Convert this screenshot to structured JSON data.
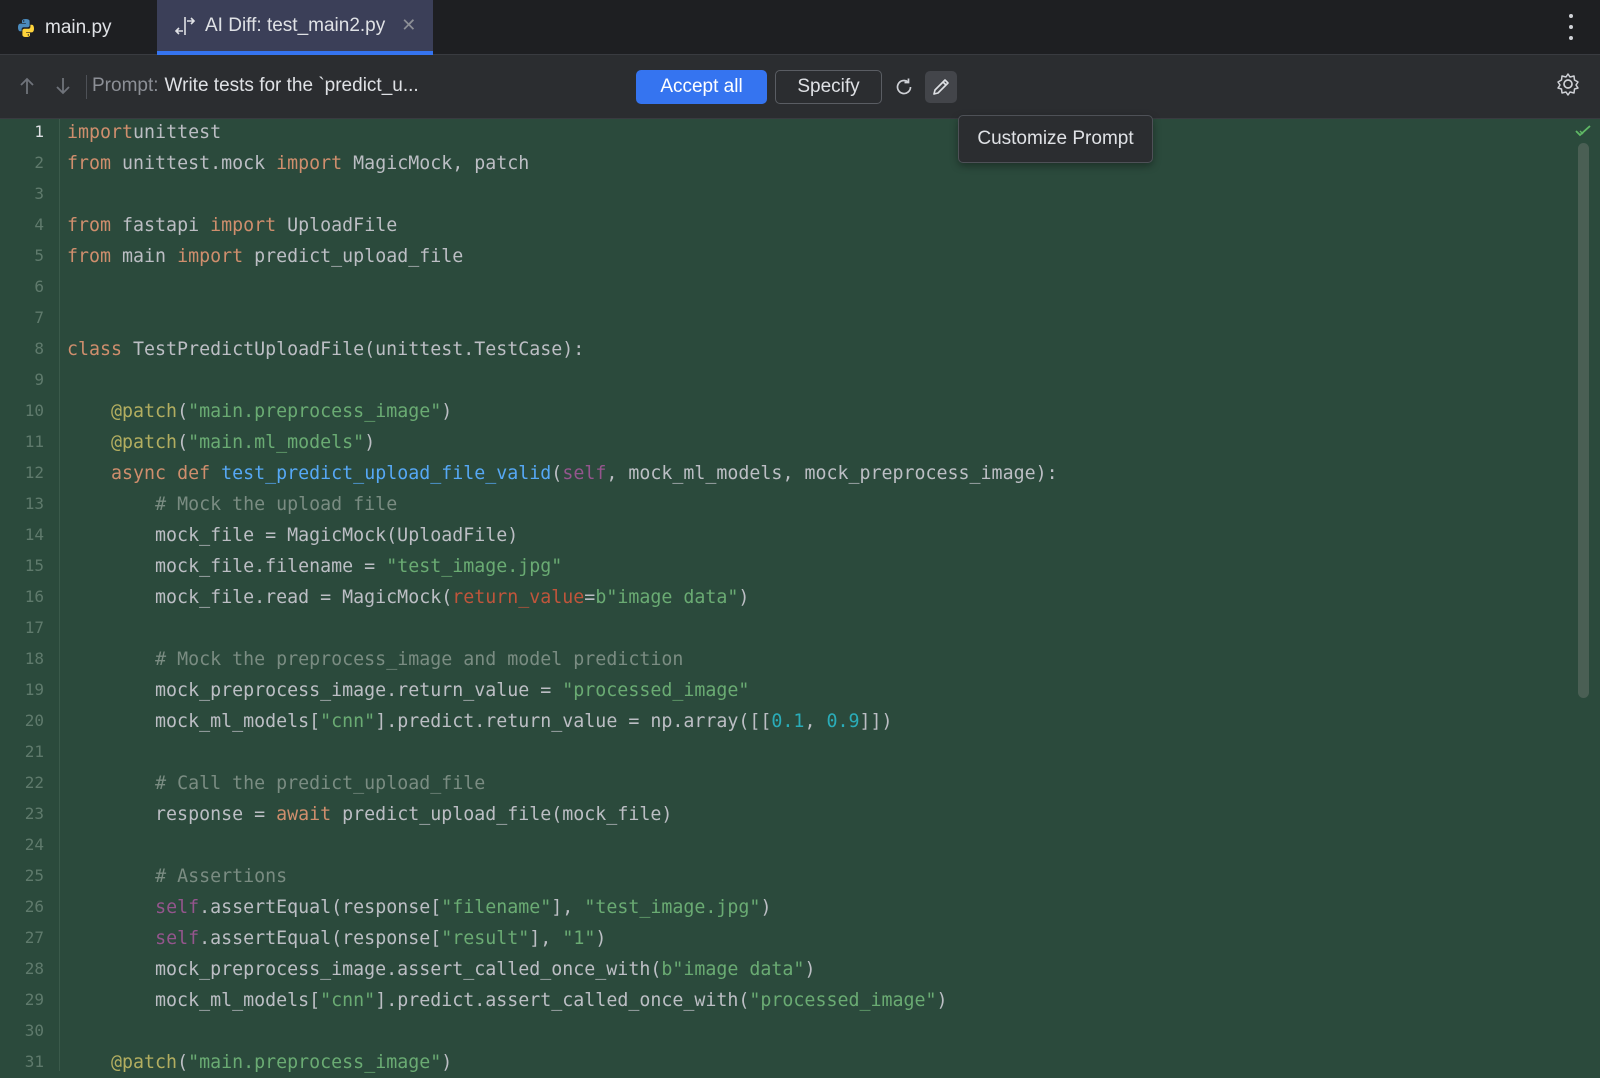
{
  "tabs": [
    {
      "label": "main.py",
      "icon": "python-icon"
    },
    {
      "label": "AI Diff: test_main2.py",
      "icon": "diff-icon",
      "active": true
    }
  ],
  "toolbar": {
    "prompt_label": "Prompt:",
    "prompt_value": "Write tests for the `predict_u...",
    "accept_label": "Accept all",
    "specify_label": "Specify"
  },
  "tooltip": "Customize Prompt",
  "colors": {
    "accent": "#3574f0",
    "editor_bg": "#2b4a3c",
    "keyword": "#cf8e6d",
    "string": "#6aab73",
    "number": "#2aacb8",
    "function": "#56a8f5",
    "decorator": "#b3ae60"
  },
  "code_lines": [
    [
      [
        "kw",
        "import"
      ],
      [
        "",
        "unittest"
      ]
    ],
    [
      [
        "kw",
        "from"
      ],
      [
        "",
        " unittest.mock "
      ],
      [
        "kw",
        "import"
      ],
      [
        "",
        " MagicMock, patch"
      ]
    ],
    [],
    [
      [
        "kw",
        "from"
      ],
      [
        "",
        " fastapi "
      ],
      [
        "kw",
        "import"
      ],
      [
        "",
        " UploadFile"
      ]
    ],
    [
      [
        "kw",
        "from"
      ],
      [
        "",
        " main "
      ],
      [
        "kw",
        "import"
      ],
      [
        "",
        " predict_upload_file"
      ]
    ],
    [],
    [],
    [
      [
        "kw",
        "class"
      ],
      [
        "",
        " TestPredictUploadFile(unittest.TestCase):"
      ]
    ],
    [],
    [
      [
        "",
        "    "
      ],
      [
        "dec",
        "@patch"
      ],
      [
        "",
        "("
      ],
      [
        "str",
        "\"main.preprocess_image\""
      ],
      [
        "",
        ")"
      ]
    ],
    [
      [
        "",
        "    "
      ],
      [
        "dec",
        "@patch"
      ],
      [
        "",
        "("
      ],
      [
        "str",
        "\"main.ml_models\""
      ],
      [
        "",
        ")"
      ]
    ],
    [
      [
        "",
        "    "
      ],
      [
        "kw",
        "async def"
      ],
      [
        "",
        " "
      ],
      [
        "fn",
        "test_predict_upload_file_valid"
      ],
      [
        "",
        "("
      ],
      [
        "slf",
        "self"
      ],
      [
        "",
        ", mock_ml_models, mock_preprocess_image):"
      ]
    ],
    [
      [
        "",
        "        "
      ],
      [
        "cm",
        "# Mock the upload file"
      ]
    ],
    [
      [
        "",
        "        mock_file = MagicMock(UploadFile)"
      ]
    ],
    [
      [
        "",
        "        mock_file.filename = "
      ],
      [
        "str",
        "\"test_image.jpg\""
      ]
    ],
    [
      [
        "",
        "        mock_file.read = MagicMock("
      ],
      [
        "prm",
        "return_value"
      ],
      [
        "",
        "="
      ],
      [
        "str",
        "b\"image data\""
      ],
      [
        "",
        ")"
      ]
    ],
    [],
    [
      [
        "",
        "        "
      ],
      [
        "cm",
        "# Mock the preprocess_image and model prediction"
      ]
    ],
    [
      [
        "",
        "        mock_preprocess_image.return_value = "
      ],
      [
        "str",
        "\"processed_image\""
      ]
    ],
    [
      [
        "",
        "        mock_ml_models["
      ],
      [
        "str",
        "\"cnn\""
      ],
      [
        "",
        "].predict.return_value = np.array([["
      ],
      [
        "num",
        "0.1"
      ],
      [
        "",
        ", "
      ],
      [
        "num",
        "0.9"
      ],
      [
        "",
        "]])"
      ]
    ],
    [],
    [
      [
        "",
        "        "
      ],
      [
        "cm",
        "# Call the predict_upload_file"
      ]
    ],
    [
      [
        "",
        "        response = "
      ],
      [
        "kw",
        "await"
      ],
      [
        "",
        " predict_upload_file(mock_file)"
      ]
    ],
    [],
    [
      [
        "",
        "        "
      ],
      [
        "cm",
        "# Assertions"
      ]
    ],
    [
      [
        "",
        "        "
      ],
      [
        "slf",
        "self"
      ],
      [
        "",
        ".assertEqual(response["
      ],
      [
        "str",
        "\"filename\""
      ],
      [
        "",
        "], "
      ],
      [
        "str",
        "\"test_image.jpg\""
      ],
      [
        "",
        ")"
      ]
    ],
    [
      [
        "",
        "        "
      ],
      [
        "slf",
        "self"
      ],
      [
        "",
        ".assertEqual(response["
      ],
      [
        "str",
        "\"result\""
      ],
      [
        "",
        "], "
      ],
      [
        "str",
        "\"1\""
      ],
      [
        "",
        ")"
      ]
    ],
    [
      [
        "",
        "        mock_preprocess_image.assert_called_once_with("
      ],
      [
        "str",
        "b\"image data\""
      ],
      [
        "",
        ")"
      ]
    ],
    [
      [
        "",
        "        mock_ml_models["
      ],
      [
        "str",
        "\"cnn\""
      ],
      [
        "",
        "].predict.assert_called_once_with("
      ],
      [
        "str",
        "\"processed_image\""
      ],
      [
        "",
        ")"
      ]
    ],
    [],
    [
      [
        "",
        "    "
      ],
      [
        "dec",
        "@patch"
      ],
      [
        "",
        "("
      ],
      [
        "str",
        "\"main.preprocess_image\""
      ],
      [
        "",
        ")"
      ]
    ]
  ]
}
